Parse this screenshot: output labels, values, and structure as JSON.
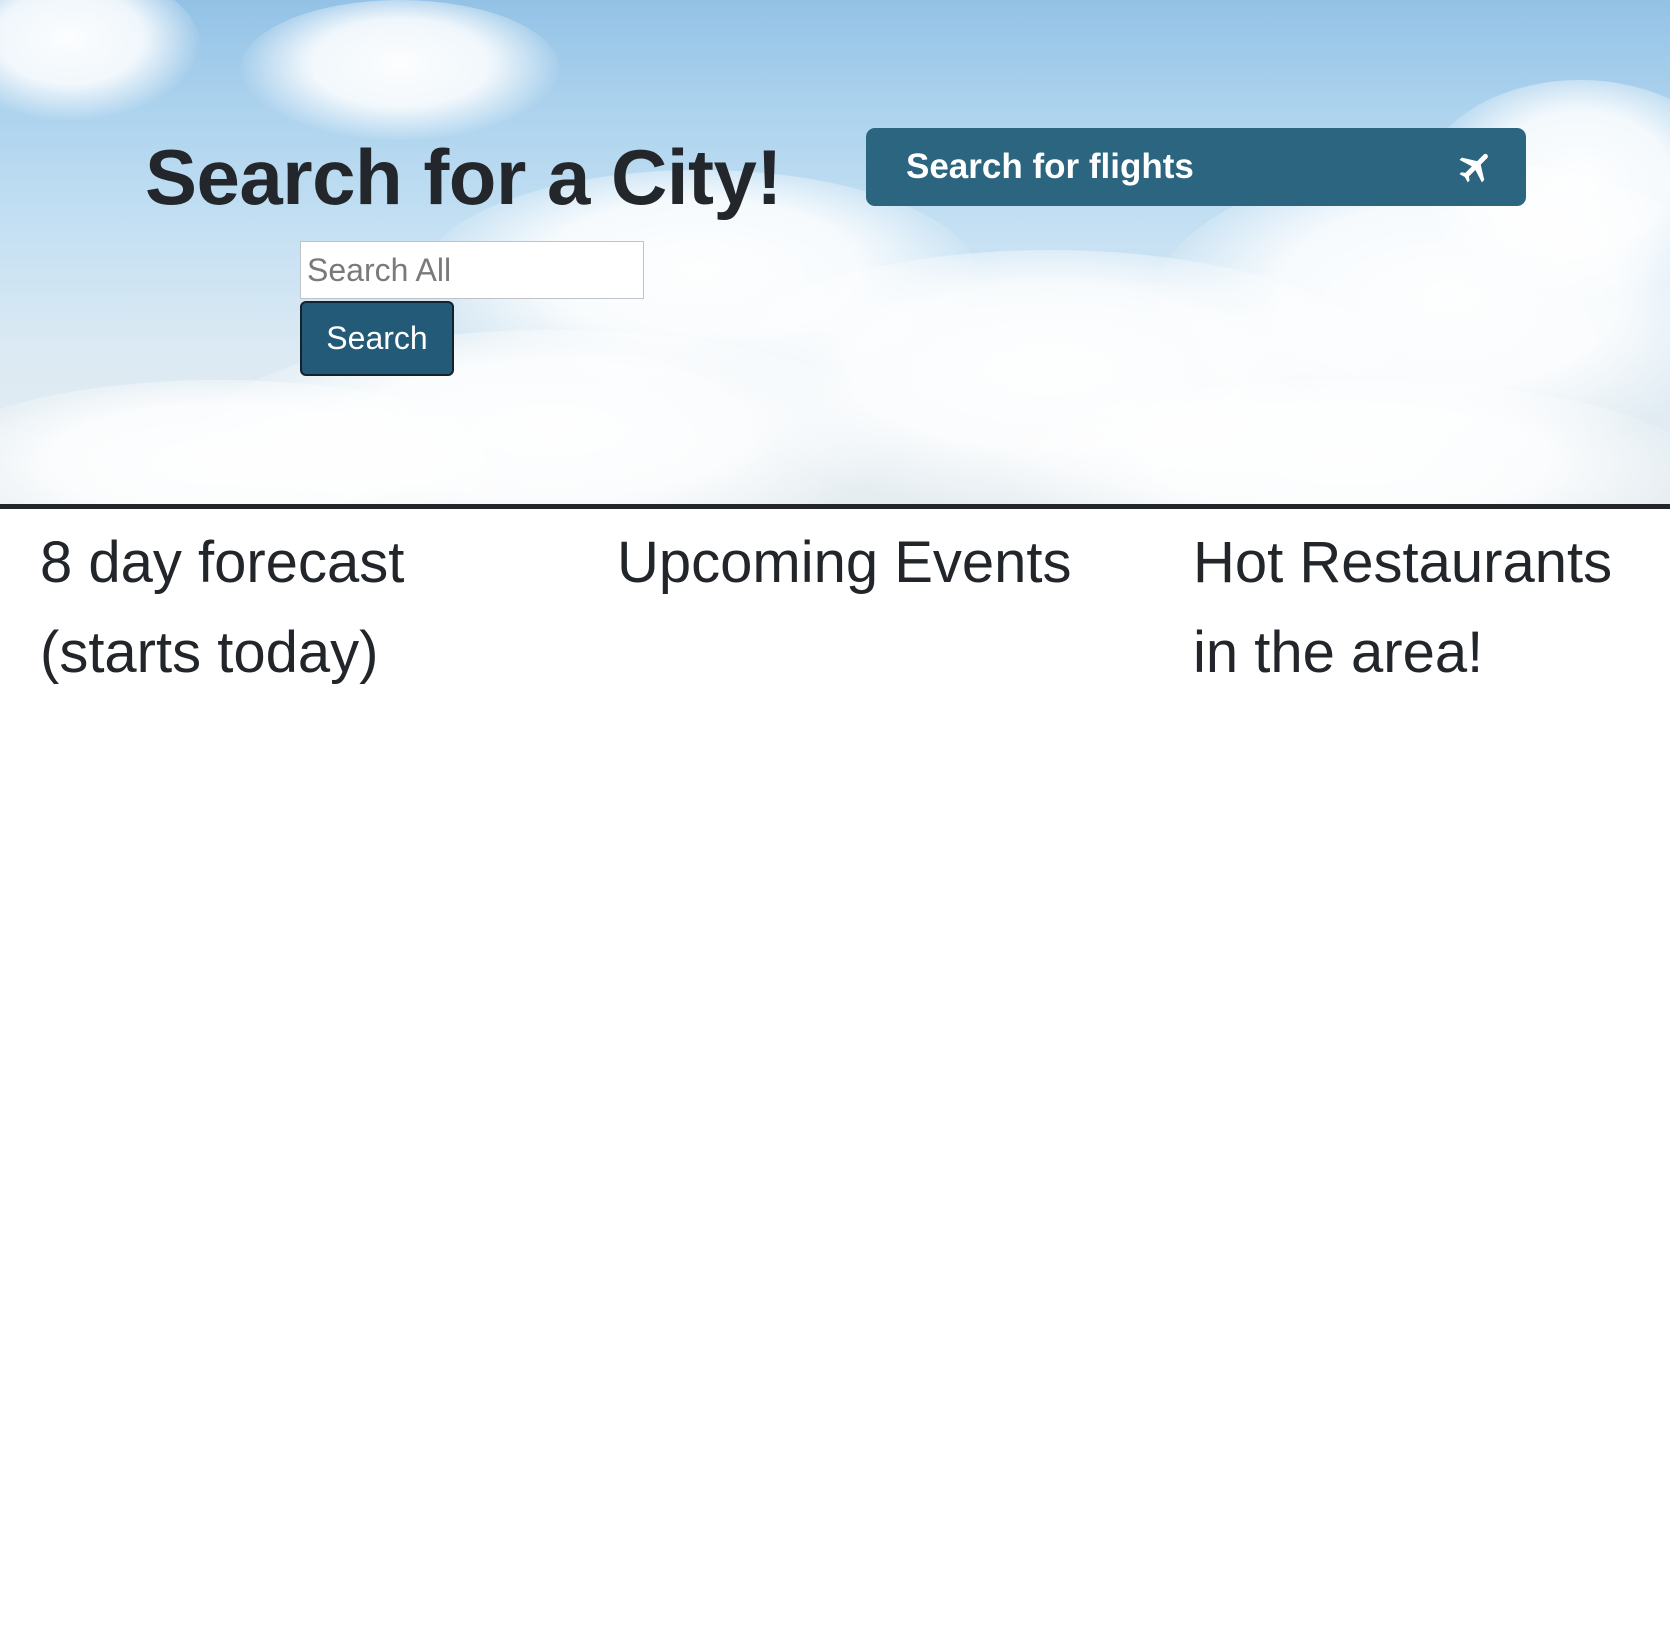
{
  "hero": {
    "title": "Search for a City!",
    "search": {
      "placeholder": "Search All",
      "value": "",
      "button_label": "Search"
    },
    "flights_button": {
      "label": "Search for flights",
      "icon": "airplane-icon"
    }
  },
  "sections": [
    {
      "heading": "8 day forecast (starts today)"
    },
    {
      "heading": "Upcoming Events"
    },
    {
      "heading": "Hot Restaurants in the area!"
    }
  ],
  "colors": {
    "button_primary": "#235a78",
    "flights_button": "#2b657f",
    "text": "#22262a",
    "divider": "#22262a"
  }
}
